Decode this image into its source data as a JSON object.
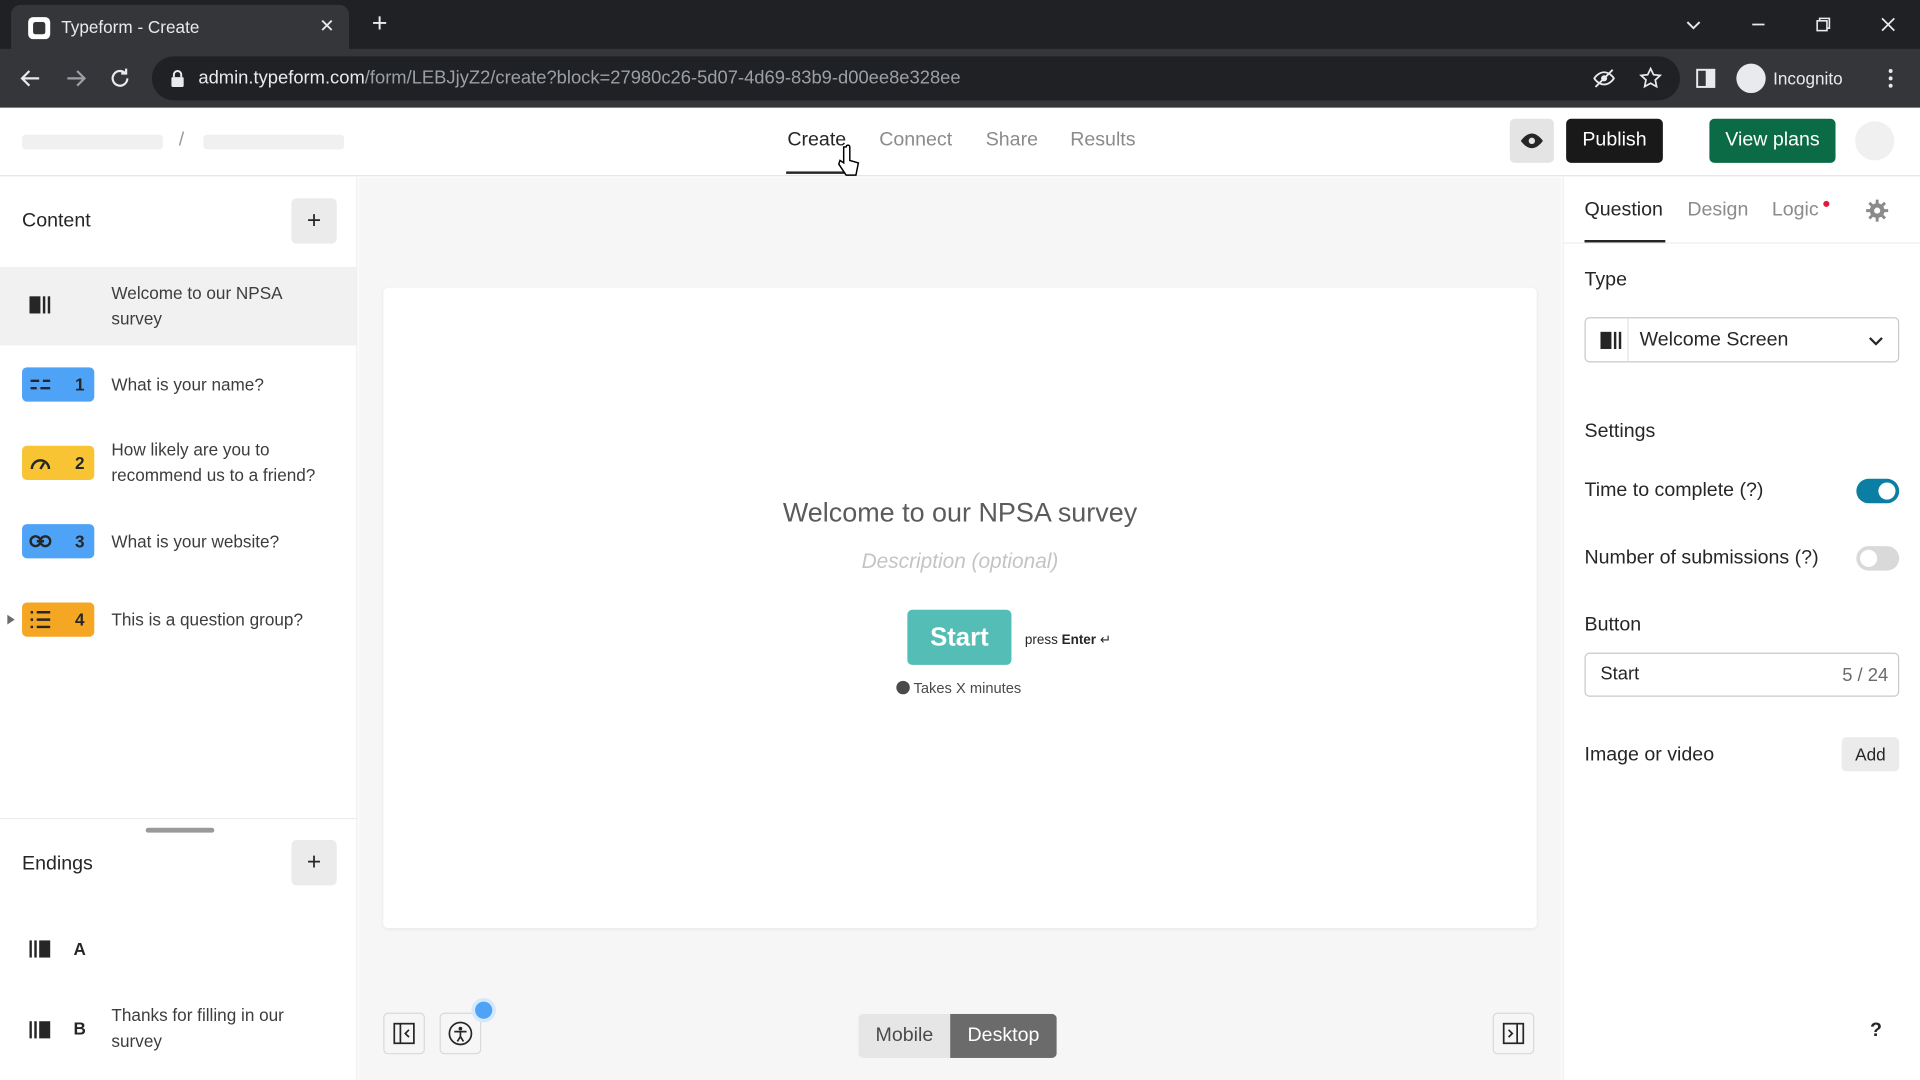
{
  "browser": {
    "tab_title": "Typeform - Create",
    "url_domain": "admin.typeform.com",
    "url_path": "/form/LEBJjyZ2/create?block=27980c26-5d07-4d69-83b9-d00ee8e328ee",
    "profile_label": "Incognito"
  },
  "header": {
    "breadcrumb_separator": "/",
    "tabs": [
      {
        "label": "Create",
        "active": true
      },
      {
        "label": "Connect",
        "active": false
      },
      {
        "label": "Share",
        "active": false
      },
      {
        "label": "Results",
        "active": false
      }
    ],
    "publish_label": "Publish",
    "view_plans_label": "View plans"
  },
  "sidebar": {
    "content_title": "Content",
    "add_label": "+",
    "items": [
      {
        "number": "",
        "label": "Welcome to our NPSA survey",
        "icon": "welcome-screen-icon",
        "color": ""
      },
      {
        "number": "1",
        "label": "What is your name?",
        "icon": "short-text-icon",
        "color": "#4fa3f7"
      },
      {
        "number": "2",
        "label": "How likely are you to recommend us to a friend?",
        "icon": "gauge-icon",
        "color": "#f8c433"
      },
      {
        "number": "3",
        "label": "What is your website?",
        "icon": "link-icon",
        "color": "#4fa3f7"
      },
      {
        "number": "4",
        "label": "This is a question group?",
        "icon": "list-icon",
        "color": "#f5a623"
      }
    ],
    "endings_title": "Endings",
    "endings": [
      {
        "letter": "A",
        "label": ""
      },
      {
        "letter": "B",
        "label": "Thanks for filling in our survey"
      }
    ]
  },
  "canvas": {
    "title": "Welcome to our NPSA survey",
    "description_placeholder": "Description (optional)",
    "start_label": "Start",
    "press_text": "press",
    "press_key": "Enter",
    "press_glyph": "↵",
    "takes_text": "Takes X minutes",
    "view_modes": [
      "Mobile",
      "Desktop"
    ],
    "active_view": "Desktop"
  },
  "panel": {
    "tabs": [
      "Question",
      "Design",
      "Logic"
    ],
    "active_tab": "Question",
    "type_label": "Type",
    "type_value": "Welcome Screen",
    "settings_label": "Settings",
    "time_to_complete_label": "Time to complete (?)",
    "time_to_complete_on": true,
    "submissions_label": "Number of submissions (?)",
    "submissions_on": false,
    "button_label": "Button",
    "button_value": "Start",
    "button_count": "5 / 24",
    "media_label": "Image or video",
    "media_add_label": "Add",
    "help_label": "?"
  },
  "colors": {
    "publish": "#191919",
    "view_plans": "#0b6b47",
    "start_button": "#54bdb5",
    "toggle_on": "#0b7fa3",
    "logic_dot": "#e1193c"
  }
}
